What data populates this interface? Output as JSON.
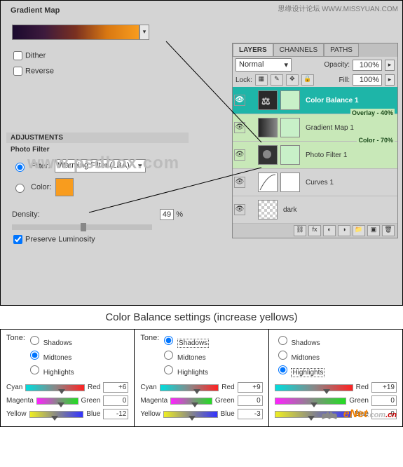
{
  "watermark_top": "思缘设计论坛  WWW.MISSYUAN.COM",
  "watermark_mid": "www.psdbox.com",
  "gradientMap": {
    "title": "Gradient Map",
    "dither": "Dither",
    "reverse": "Reverse"
  },
  "adjustments": {
    "title": "ADJUSTMENTS",
    "panel": "Photo Filter",
    "filterLabel": "Filter:",
    "filterValue": "Warming Filter (LBA)",
    "colorLabel": "Color:",
    "colorHex": "#f89c1e",
    "densityLabel": "Density:",
    "densityValue": "49",
    "densityUnit": "%",
    "preserve": "Preserve Luminosity"
  },
  "layersPanel": {
    "tabs": [
      "LAYERS",
      "CHANNELS",
      "PATHS"
    ],
    "blend": "Normal",
    "opacityLabel": "Opacity:",
    "opacityValue": "100%",
    "lockLabel": "Lock:",
    "fillLabel": "Fill:",
    "fillValue": "100%",
    "layers": [
      {
        "name": "Color Balance 1"
      },
      {
        "name": "Gradient Map 1",
        "overlay": "Overlay - 40%"
      },
      {
        "name": "Photo Filter 1",
        "overlay": "Color - 70%"
      },
      {
        "name": "Curves 1"
      },
      {
        "name": "dark"
      }
    ]
  },
  "cbTitle": "Color Balance settings (increase yellows)",
  "tone": {
    "label": "Tone:",
    "shadows": "Shadows",
    "midtones": "Midtones",
    "highlights": "Highlights"
  },
  "sliders": {
    "cyan": "Cyan",
    "red": "Red",
    "magenta": "Magenta",
    "green": "Green",
    "yellow": "Yellow",
    "blue": "Blue"
  },
  "cb": [
    {
      "sel": "midtones",
      "cr": "+6",
      "mg": "0",
      "yb": "-12",
      "crPos": 55,
      "mgPos": 50,
      "ybPos": 40
    },
    {
      "sel": "shadows",
      "cr": "+9",
      "mg": "0",
      "yb": "-3",
      "crPos": 57,
      "mgPos": 50,
      "ybPos": 47
    },
    {
      "sel": "highlights",
      "cr": "+19",
      "mg": "0",
      "yb": "-9",
      "crPos": 62,
      "mgPos": 50,
      "ybPos": 43
    }
  ],
  "logo": {
    "e": "e",
    "net": "Net",
    "com": ".com",
    "cn": ".cn"
  }
}
